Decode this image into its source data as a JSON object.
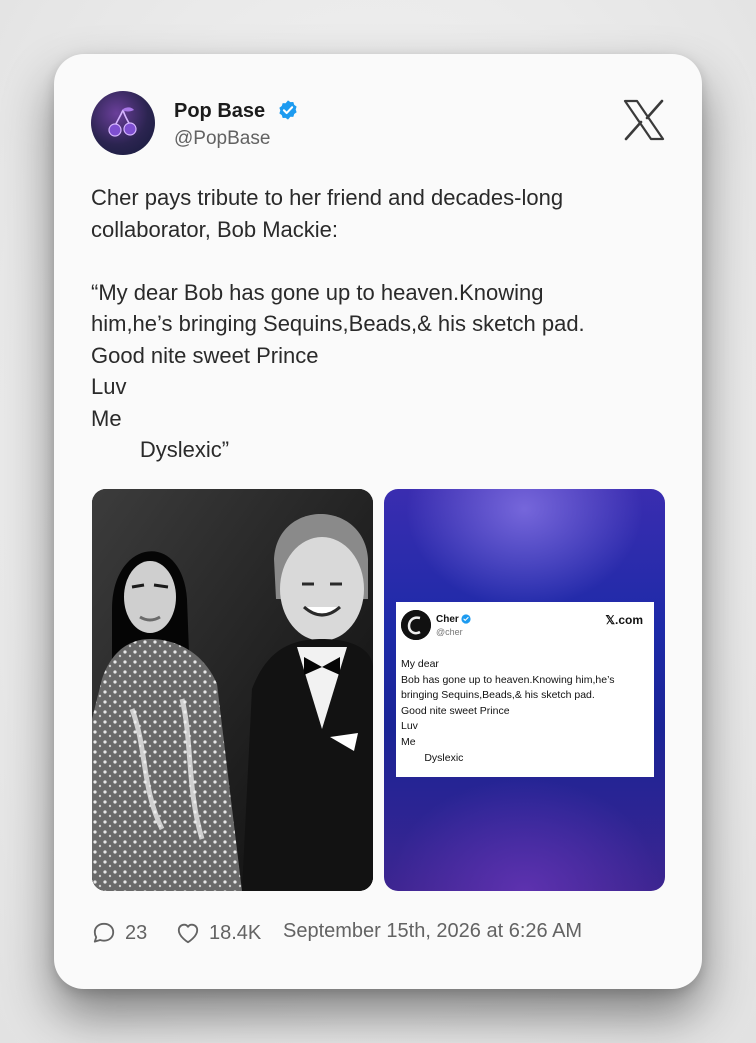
{
  "author": {
    "name": "Pop Base",
    "handle": "@PopBase",
    "verified": true,
    "avatar_icon": "cherry-icon"
  },
  "platform_icon": "x-logo-icon",
  "tweet_text": "Cher pays tribute to her friend and decades-long\ncollaborator, Bob Mackie:\n\n“My dear Bob has gone up to heaven.Knowing\nhim,he’s bringing Sequins,Beads,& his sketch pad.\nGood nite sweet Prince\nLuv\nMe\n        Dyslexic”",
  "media": [
    {
      "type": "photo"
    },
    {
      "type": "embedded-post",
      "name": "Cher",
      "handle": "@cher",
      "source": "𝕏.com",
      "text": "My dear\nBob has gone up to heaven.Knowing him,he’s\nbringing Sequins,Beads,& his sketch pad.\nGood nite sweet Prince\nLuv\nMe\n        Dyslexic"
    }
  ],
  "footer": {
    "replies": "23",
    "likes": "18.4K",
    "timestamp": "September 15th, 2026 at 6:26 AM"
  },
  "colors": {
    "verified": "#1d9bf0",
    "card": "#fafafa",
    "text": "#2a2a2a",
    "muted": "#636363"
  }
}
